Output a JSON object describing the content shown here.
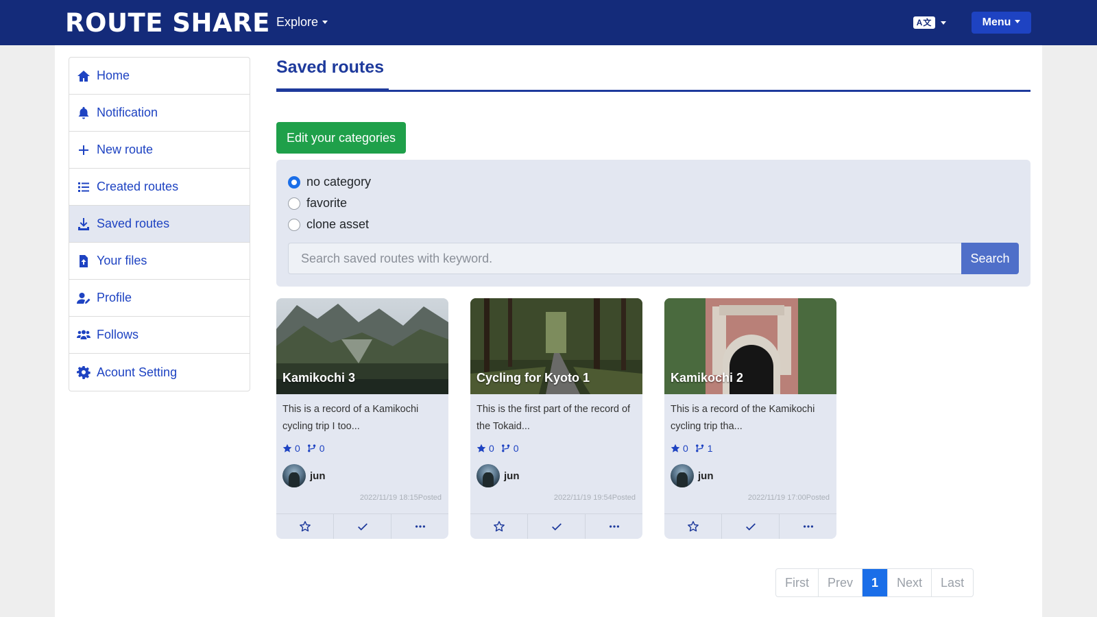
{
  "navbar": {
    "brand": "ROUTE SHARE",
    "explore_label": "Explore",
    "menu_label": "Menu"
  },
  "sidebar": {
    "items": [
      {
        "label": "Home",
        "icon": "home-icon"
      },
      {
        "label": "Notification",
        "icon": "bell-icon"
      },
      {
        "label": "New route",
        "icon": "plus-icon"
      },
      {
        "label": "Created routes",
        "icon": "list-icon"
      },
      {
        "label": "Saved routes",
        "icon": "download-icon",
        "active": true
      },
      {
        "label": "Your files",
        "icon": "file-upload-icon"
      },
      {
        "label": "Profile",
        "icon": "user-edit-icon"
      },
      {
        "label": "Follows",
        "icon": "users-icon"
      },
      {
        "label": "Acount Setting",
        "icon": "gear-icon"
      }
    ]
  },
  "main": {
    "title": "Saved routes",
    "edit_categories_label": "Edit your categories",
    "categories": [
      {
        "label": "no category",
        "checked": true
      },
      {
        "label": "favorite",
        "checked": false
      },
      {
        "label": "clone asset",
        "checked": false
      }
    ],
    "search": {
      "placeholder": "Search saved routes with keyword.",
      "button_label": "Search"
    },
    "cards": [
      {
        "title": "Kamikochi 3",
        "description": "This is a record of a Kamikochi cycling trip I too...",
        "stars": "0",
        "forks": "0",
        "author": "jun",
        "date": "2022/11/19 18:15Posted"
      },
      {
        "title": "Cycling for Kyoto 1",
        "description": "This is the first part of the record of the Tokaid...",
        "stars": "0",
        "forks": "0",
        "author": "jun",
        "date": "2022/11/19 19:54Posted"
      },
      {
        "title": "Kamikochi 2",
        "description": "This is a record of the Kamikochi cycling trip tha...",
        "stars": "0",
        "forks": "1",
        "author": "jun",
        "date": "2022/11/19 17:00Posted"
      }
    ],
    "pagination": {
      "first": "First",
      "prev": "Prev",
      "current": "1",
      "next": "Next",
      "last": "Last"
    }
  },
  "colors": {
    "navbar": "#142b7a",
    "accent": "#1e43c2",
    "success": "#1fa04a",
    "active_page": "#1a6ee8"
  }
}
